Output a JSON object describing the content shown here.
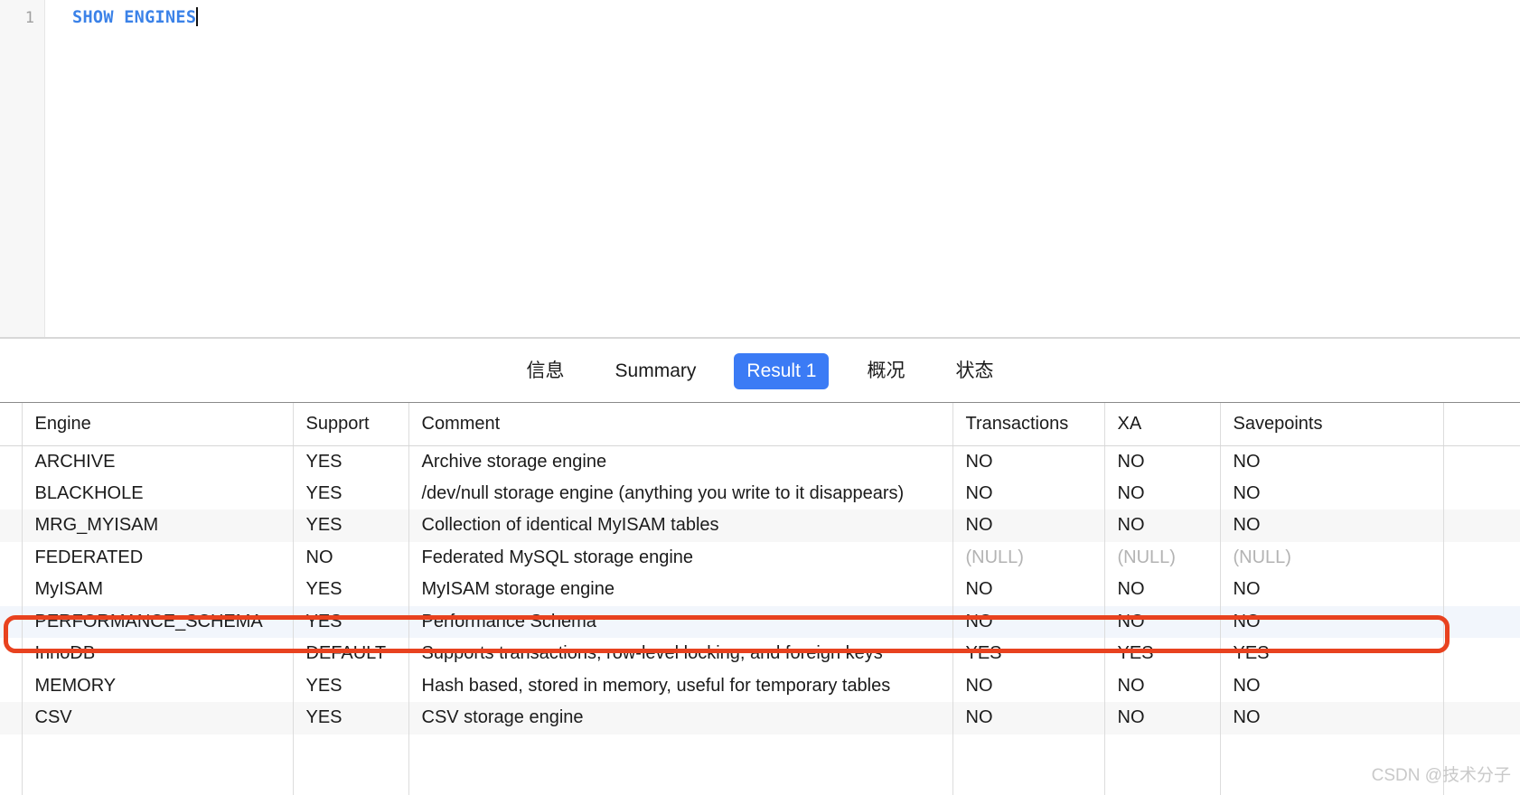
{
  "editor": {
    "line_number": "1",
    "sql_keyword_text": "SHOW ENGINES",
    "caret_visible": true
  },
  "tabs": [
    {
      "label": "信息",
      "active": false
    },
    {
      "label": "Summary",
      "active": false
    },
    {
      "label": "Result 1",
      "active": true
    },
    {
      "label": "概况",
      "active": false
    },
    {
      "label": "状态",
      "active": false
    }
  ],
  "result_table": {
    "columns": [
      "Engine",
      "Support",
      "Comment",
      "Transactions",
      "XA",
      "Savepoints"
    ],
    "rows": [
      {
        "Engine": "ARCHIVE",
        "Support": "YES",
        "Comment": "Archive storage engine",
        "Transactions": "NO",
        "XA": "NO",
        "Savepoints": "NO",
        "stripe": "none",
        "highlighted": false
      },
      {
        "Engine": "BLACKHOLE",
        "Support": "YES",
        "Comment": "/dev/null storage engine (anything you write to it disappears)",
        "Transactions": "NO",
        "XA": "NO",
        "Savepoints": "NO",
        "stripe": "none",
        "highlighted": false
      },
      {
        "Engine": "MRG_MYISAM",
        "Support": "YES",
        "Comment": "Collection of identical MyISAM tables",
        "Transactions": "NO",
        "XA": "NO",
        "Savepoints": "NO",
        "stripe": "gray",
        "highlighted": false
      },
      {
        "Engine": "FEDERATED",
        "Support": "NO",
        "Comment": "Federated MySQL storage engine",
        "Transactions": "(NULL)",
        "XA": "(NULL)",
        "Savepoints": "(NULL)",
        "stripe": "none",
        "highlighted": false
      },
      {
        "Engine": "MyISAM",
        "Support": "YES",
        "Comment": "MyISAM storage engine",
        "Transactions": "NO",
        "XA": "NO",
        "Savepoints": "NO",
        "stripe": "none",
        "highlighted": false
      },
      {
        "Engine": "PERFORMANCE_SCHEMA",
        "Support": "YES",
        "Comment": "Performance Schema",
        "Transactions": "NO",
        "XA": "NO",
        "Savepoints": "NO",
        "stripe": "blue",
        "highlighted": false
      },
      {
        "Engine": "InnoDB",
        "Support": "DEFAULT",
        "Comment": "Supports transactions, row-level locking, and foreign keys",
        "Transactions": "YES",
        "XA": "YES",
        "Savepoints": "YES",
        "stripe": "none",
        "highlighted": true
      },
      {
        "Engine": "MEMORY",
        "Support": "YES",
        "Comment": "Hash based, stored in memory, useful for temporary tables",
        "Transactions": "NO",
        "XA": "NO",
        "Savepoints": "NO",
        "stripe": "none",
        "highlighted": false
      },
      {
        "Engine": "CSV",
        "Support": "YES",
        "Comment": "CSV storage engine",
        "Transactions": "NO",
        "XA": "NO",
        "Savepoints": "NO",
        "stripe": "gray",
        "highlighted": false
      }
    ]
  },
  "annotation": {
    "color": "#e8421f",
    "target_row_engine": "InnoDB"
  },
  "watermark": {
    "text": "CSDN @技术分子"
  },
  "colors": {
    "active_tab_bg": "#3b7bf5",
    "sql_keyword": "#3b82e8",
    "null_text": "#b3b3b3",
    "stripe_gray": "#f7f7f7",
    "stripe_blue": "#f2f6fc"
  }
}
